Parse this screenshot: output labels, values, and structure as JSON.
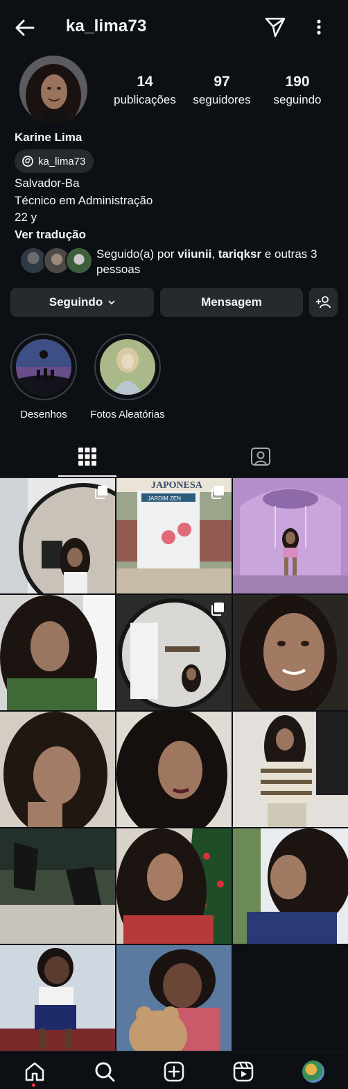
{
  "header": {
    "username": "ka_lima73"
  },
  "profile": {
    "full_name": "Karine Lima",
    "threads_handle": "ka_lima73",
    "bio": [
      "Salvador-Ba",
      "Técnico em Administração",
      "22 y"
    ],
    "see_translation": "Ver tradução"
  },
  "stats": {
    "posts": {
      "value": "14",
      "label": "publicações"
    },
    "followers": {
      "value": "97",
      "label": "seguidores"
    },
    "following": {
      "value": "190",
      "label": "seguindo"
    }
  },
  "mutual": {
    "prefix": "Seguido(a) por ",
    "user1": "viiunii",
    "sep": ", ",
    "user2": "tariqksr",
    "suffix": " e outras 3 pessoas"
  },
  "actions": {
    "following_label": "Seguindo",
    "message_label": "Mensagem"
  },
  "highlights": [
    {
      "label": "Desenhos"
    },
    {
      "label": "Fotos Aleatórias"
    }
  ],
  "posts": [
    {
      "caption": "mirror selfie",
      "multi": true
    },
    {
      "caption": "JAPONESA / JARDIM ZEN",
      "multi": true,
      "sign_top": "JAPONESA",
      "sign_mid": "JARDIM ZEN"
    },
    {
      "caption": "swing photo",
      "multi": false
    },
    {
      "caption": "selfie",
      "multi": false
    },
    {
      "caption": "round mirror selfie",
      "multi": true
    },
    {
      "caption": "selfie close-up",
      "multi": false
    },
    {
      "caption": "selfie",
      "multi": false
    },
    {
      "caption": "selfie",
      "multi": false
    },
    {
      "caption": "standing photo",
      "multi": false
    },
    {
      "caption": "sneakers",
      "multi": false
    },
    {
      "caption": "christmas tree selfie",
      "multi": false
    },
    {
      "caption": "side profile",
      "multi": false
    },
    {
      "caption": "childhood photo",
      "multi": false
    },
    {
      "caption": "childhood photo with teddy",
      "multi": false
    }
  ],
  "colors": {
    "background": "#0c1014",
    "button": "#262a2f",
    "text": "#f5f5f5",
    "notification": "#ff3040"
  },
  "nav": [
    "home-icon",
    "search-icon",
    "create-icon",
    "reels-icon",
    "profile-avatar"
  ]
}
